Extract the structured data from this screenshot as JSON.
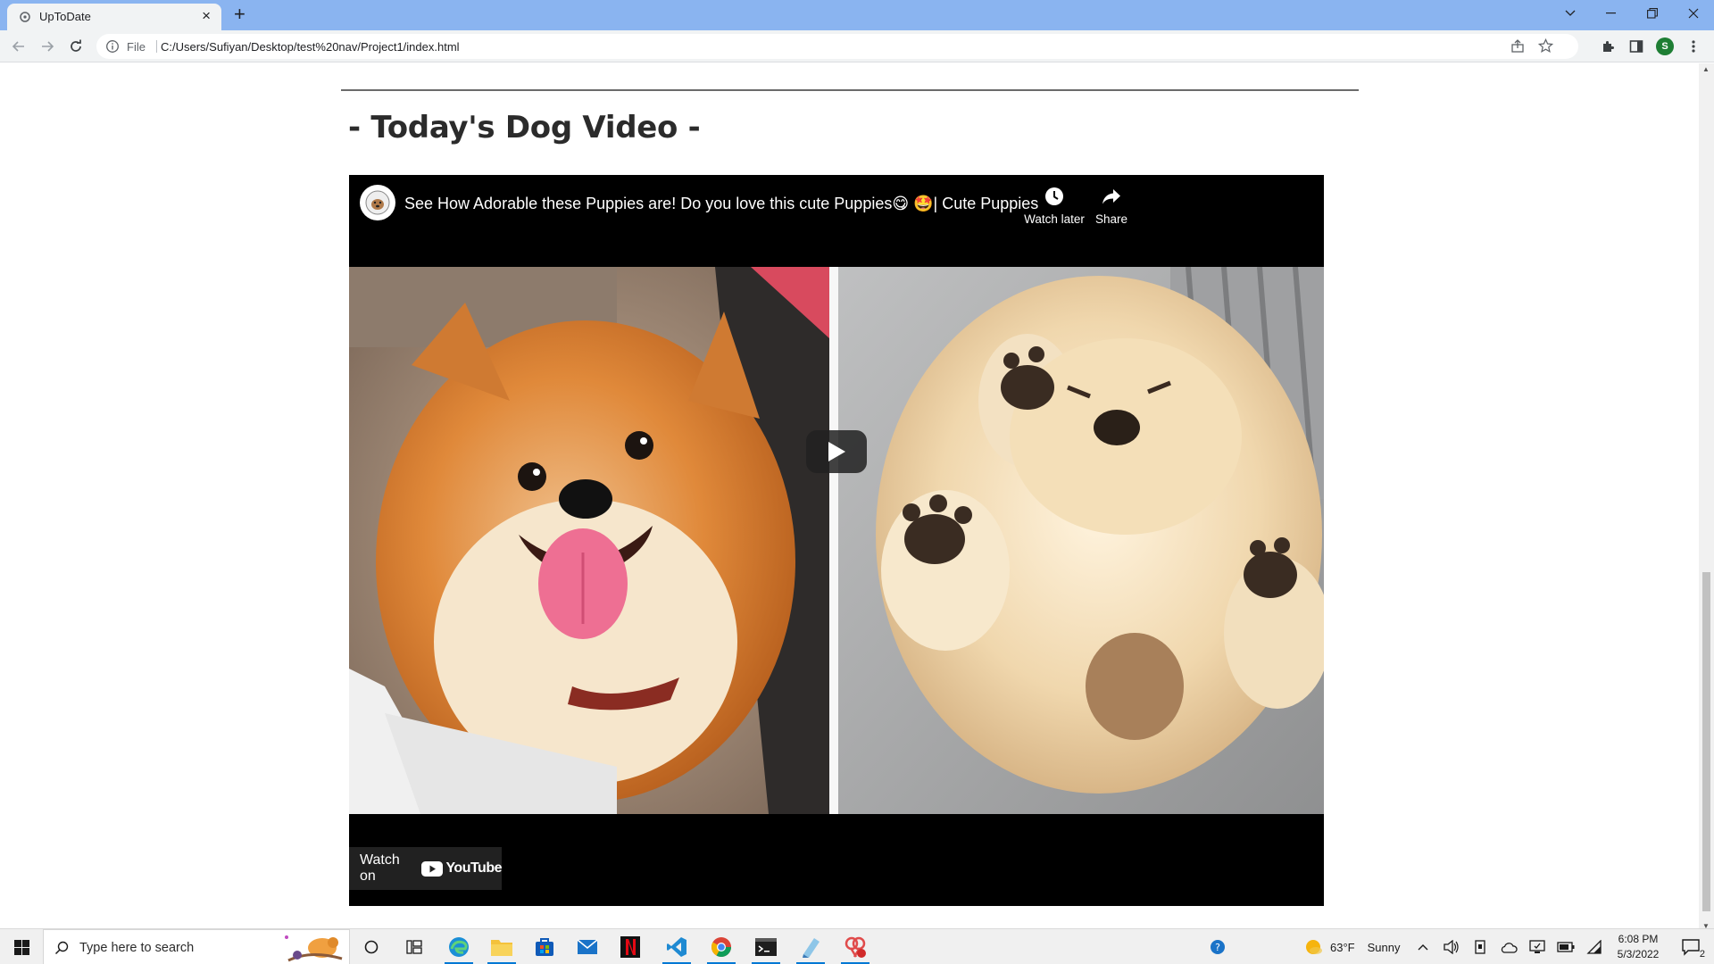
{
  "browser": {
    "tab_title": "UpToDate",
    "tab_close_glyph": "×",
    "new_tab_glyph": "+",
    "file_label": "File",
    "url": "C:/Users/Sufiyan/Desktop/test%20nav/Project1/index.html",
    "profile_initial": "S",
    "colors": {
      "tabstrip": "#8ab4f0",
      "toolbar": "#f1f3f4"
    }
  },
  "page": {
    "section_heading": "- Today's Dog Video -"
  },
  "video": {
    "title": "See How Adorable these Puppies are! Do you love this cute Puppies😋 🤩| Cute Puppies",
    "watch_later_label": "Watch later",
    "share_label": "Share",
    "watch_on_label": "Watch on",
    "youtube_label": "YouTube",
    "icons": [
      "clock-icon",
      "share-icon",
      "play-icon",
      "youtube-logo"
    ]
  },
  "taskbar": {
    "search_placeholder": "Type here to search",
    "weather_temp": "63°F",
    "weather_text": "Sunny",
    "time": "6:08 PM",
    "date": "5/3/2022",
    "notification_count": "2"
  }
}
